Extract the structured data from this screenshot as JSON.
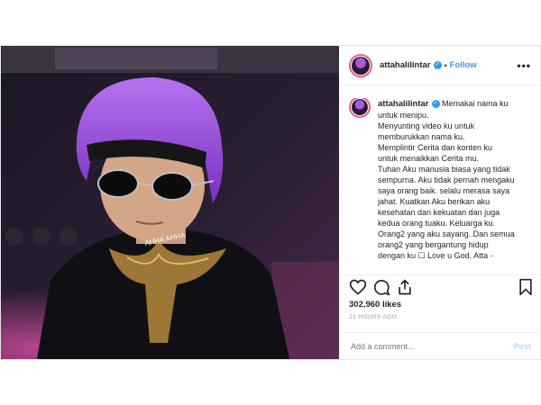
{
  "header": {
    "username": "attahalilintar",
    "dot": "•",
    "follow_label": "Follow",
    "more_label": "•••"
  },
  "caption": {
    "username": "attahalilintar",
    "lines": [
      "Memakai nama ku",
      "untuk menipu.",
      "Menyunting video ku untuk",
      "memburukkan nama ku.",
      "Memplintir Cerita dan konten ku",
      "untuk menaikkan Cerita mu.",
      "Tuhan Aku manusia biasa yang tidak",
      "sempurna. Aku tidak pernah mengaku",
      "saya orang baik. selalu merasa saya",
      "jahat. Kuatkan Aku berikan aku",
      "kesehatan dan kekuatan dan juga",
      "kedua orang tuaku. Keluarga ku.",
      "Orang2 yang aku sayang. Dan semua",
      "orang2 yang bergantung hidup",
      "dengan ku ☐ Love u God. Atta -"
    ]
  },
  "photo": {
    "headband_text": "AHHA AHHA"
  },
  "stats": {
    "likes": "302,960 likes",
    "time": "21 HOURS AGO"
  },
  "comment": {
    "placeholder": "Add a comment...",
    "post_label": "Post"
  },
  "colors": {
    "accent": "#3897f0",
    "hair": "#8e3fd0",
    "border": "#efefef"
  },
  "icons": [
    "verified-icon",
    "heart-icon",
    "comment-icon",
    "share-icon",
    "bookmark-icon",
    "more-icon"
  ]
}
